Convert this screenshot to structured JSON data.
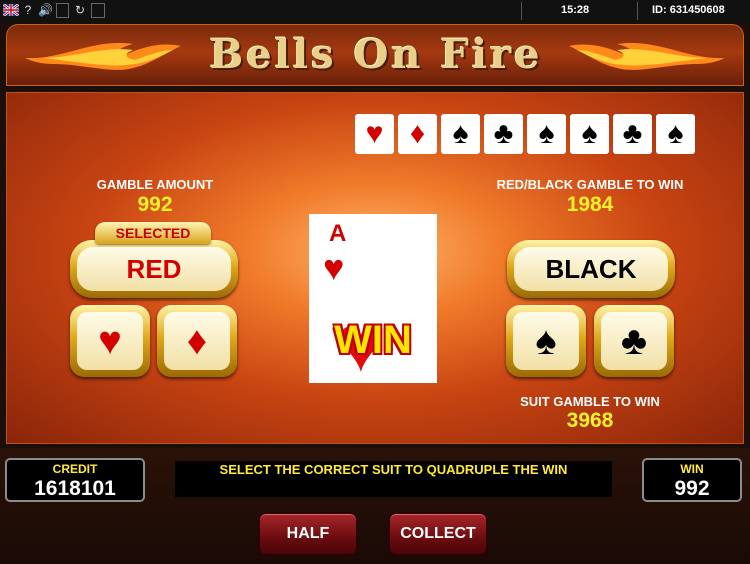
{
  "topbar": {
    "flag_icon": "uk-flag-icon",
    "help_label": "?",
    "time": "15:28",
    "id_label": "ID: 631450608"
  },
  "header": {
    "title": "Bells On Fire"
  },
  "history": {
    "cards": [
      {
        "suit": "♥",
        "color": "#d40000"
      },
      {
        "suit": "♦",
        "color": "#d40000"
      },
      {
        "suit": "♠",
        "color": "#000000"
      },
      {
        "suit": "♣",
        "color": "#000000"
      },
      {
        "suit": "♠",
        "color": "#000000"
      },
      {
        "suit": "♠",
        "color": "#000000"
      },
      {
        "suit": "♣",
        "color": "#000000"
      },
      {
        "suit": "♠",
        "color": "#000000"
      }
    ]
  },
  "gamble": {
    "amount_label": "GAMBLE AMOUNT",
    "amount_value": "992",
    "selected_label": "SELECTED",
    "red_label": "RED",
    "black_label": "BLACK",
    "heart": "♥",
    "diamond": "♦",
    "spade": "♠",
    "club": "♣",
    "redblack_label": "RED/BLACK GAMBLE TO WIN",
    "redblack_value": "1984",
    "suit_label": "SUIT GAMBLE TO WIN",
    "suit_value": "3968"
  },
  "card": {
    "rank": "A",
    "suit": "♥",
    "win_text": "WIN"
  },
  "footer": {
    "credit_label": "CREDIT",
    "credit_value": "1618101",
    "message": "SELECT THE CORRECT SUIT TO QUADRUPLE THE WIN",
    "win_label": "WIN",
    "win_value": "992",
    "half_label": "HALF",
    "collect_label": "COLLECT"
  },
  "colors": {
    "accent_yellow": "#fff12a",
    "red_suit": "#d40000",
    "gold": "#e0a91a"
  }
}
